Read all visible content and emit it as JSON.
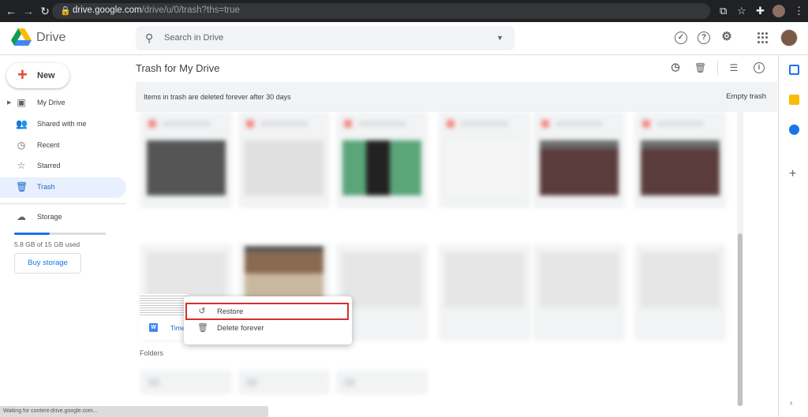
{
  "browser": {
    "url_host": "drive.google.com",
    "url_path": "/drive/u/0/trash?ths=true",
    "status": "Waiting for content-drive.google.com..."
  },
  "app": {
    "name": "Drive",
    "search_placeholder": "Search in Drive"
  },
  "sidebar": {
    "new_label": "New",
    "items": [
      {
        "label": "My Drive",
        "icon": "my-drive-icon"
      },
      {
        "label": "Shared with me",
        "icon": "people-icon"
      },
      {
        "label": "Recent",
        "icon": "clock-icon"
      },
      {
        "label": "Starred",
        "icon": "star-icon"
      },
      {
        "label": "Trash",
        "icon": "trash-icon",
        "active": true
      }
    ],
    "storage_label": "Storage",
    "storage_used": "5.8 GB of 15 GB used",
    "storage_fraction": 0.39,
    "buy_label": "Buy storage"
  },
  "main": {
    "title": "Trash for My Drive",
    "banner_text": "Items in trash are deleted forever after 30 days",
    "empty_trash": "Empty trash",
    "folders_label": "Folders",
    "visible_file_name": "Time",
    "visible_file_badge": "W"
  },
  "context_menu": {
    "items": [
      {
        "label": "Restore",
        "icon": "restore-icon"
      },
      {
        "label": "Delete forever",
        "icon": "trash-icon"
      }
    ]
  },
  "colors": {
    "accent": "#1a73e8",
    "highlight_border": "#d32f2f",
    "active_nav": "#e8f0fe"
  }
}
